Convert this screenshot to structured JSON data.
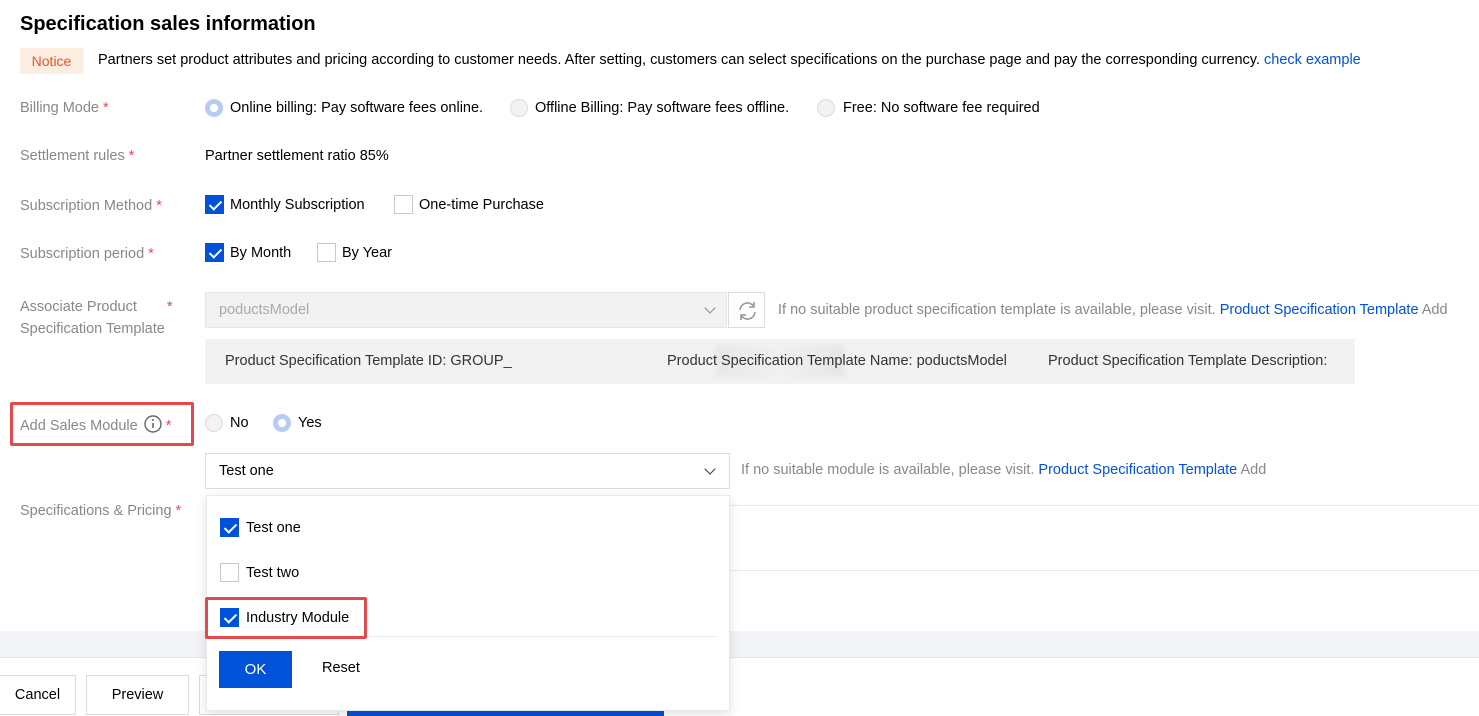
{
  "title": "Specification sales information",
  "notice": {
    "badge": "Notice",
    "text": "Partners set product attributes and pricing according to customer needs. After setting, customers can select specifications on the purchase page and pay the corresponding currency.",
    "link": "check example"
  },
  "required_mark": "*",
  "billing_mode": {
    "label": "Billing Mode",
    "options": [
      {
        "label": "Online billing: Pay software fees online.",
        "selected": true
      },
      {
        "label": "Offline Billing: Pay software fees offline.",
        "selected": false
      },
      {
        "label": "Free: No software fee required",
        "selected": false
      }
    ]
  },
  "settlement": {
    "label": "Settlement rules",
    "value": "Partner settlement ratio 85%"
  },
  "subscription_method": {
    "label": "Subscription Method",
    "options": [
      {
        "label": "Monthly Subscription",
        "checked": true
      },
      {
        "label": "One-time Purchase",
        "checked": false
      }
    ]
  },
  "subscription_period": {
    "label": "Subscription period",
    "options": [
      {
        "label": "By Month",
        "checked": true
      },
      {
        "label": "By Year",
        "checked": false
      }
    ]
  },
  "template": {
    "label_line1": "Associate Product",
    "label_line2": "Specification Template",
    "select_value": "poductsModel",
    "hint": "If no suitable product specification template is available, please visit.",
    "hint_link": "Product Specification Template",
    "hint_add": "Add",
    "info": {
      "id_label": "Product Specification Template ID: GROUP_",
      "name_label": "Product Specification Template Name: poductsModel",
      "desc_label": "Product Specification Template Description:"
    }
  },
  "sales_module": {
    "label": "Add Sales Module",
    "options": [
      {
        "label": "No",
        "selected": false
      },
      {
        "label": "Yes",
        "selected": true
      }
    ],
    "select_value": "Test one",
    "hint": "If no suitable module is available, please visit.",
    "hint_link": "Product Specification Template",
    "hint_add": "Add"
  },
  "dropdown": {
    "items": [
      {
        "label": "Test one",
        "checked": true
      },
      {
        "label": "Test two",
        "checked": false
      },
      {
        "label": "Industry Module",
        "checked": true
      }
    ],
    "ok_label": "OK",
    "reset_label": "Reset"
  },
  "pricing": {
    "label": "Specifications & Pricing"
  },
  "footer": {
    "cancel_label": "Cancel",
    "preview_label": "Preview"
  },
  "colors": {
    "accent": "#0052d9",
    "highlight": "#e5484d",
    "required": "#e34d59",
    "notice_bg": "#fdece0",
    "notice_text": "#e5592b"
  }
}
